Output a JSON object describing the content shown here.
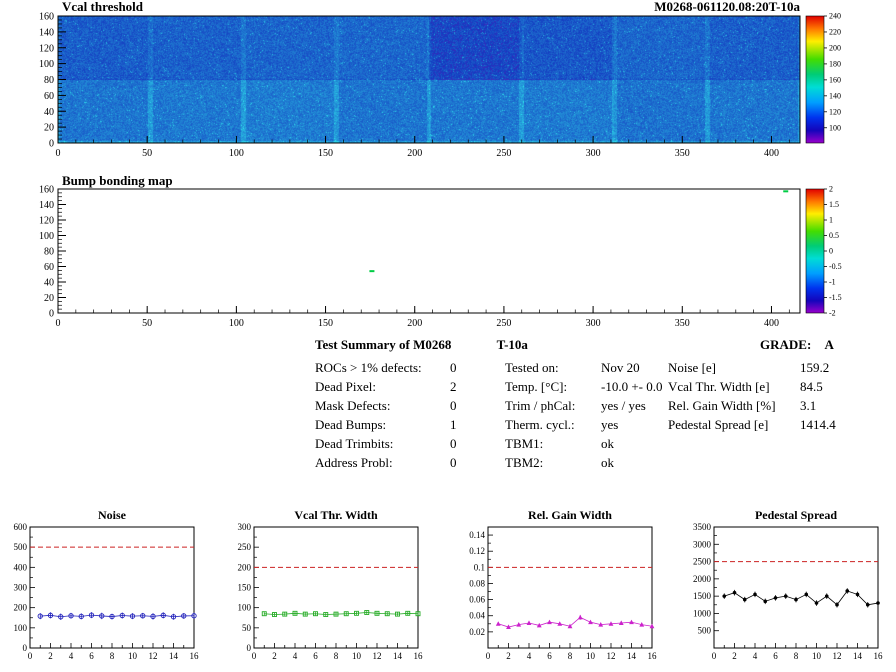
{
  "summary": {
    "title": "Test Summary of M0268",
    "subtitle": "T-10a",
    "grade_label": "GRADE:",
    "grade": "A",
    "defects": [
      {
        "label": "ROCs > 1% defects:",
        "value": "0"
      },
      {
        "label": "Dead Pixel:",
        "value": "2"
      },
      {
        "label": "Mask Defects:",
        "value": "0"
      },
      {
        "label": "Dead Bumps:",
        "value": "1"
      },
      {
        "label": "Dead Trimbits:",
        "value": "0"
      },
      {
        "label": "Address Probl:",
        "value": "0"
      }
    ],
    "conditions": [
      {
        "label": "Tested on:",
        "value": "Nov 20"
      },
      {
        "label": "Temp. [°C]:",
        "value": "-10.0 +- 0.0"
      },
      {
        "label": "Trim / phCal:",
        "value": "yes / yes"
      },
      {
        "label": "Therm. cycl.:",
        "value": "yes"
      },
      {
        "label": "TBM1:",
        "value": "ok"
      },
      {
        "label": "TBM2:",
        "value": "ok"
      }
    ],
    "results": [
      {
        "label": "Noise [e]",
        "value": "159.2"
      },
      {
        "label": "Vcal Thr. Width [e]",
        "value": "84.5"
      },
      {
        "label": "Rel. Gain Width [%]",
        "value": "3.1"
      },
      {
        "label": "Pedestal Spread [e]",
        "value": "1414.4"
      }
    ]
  },
  "chart_data": [
    {
      "id": "vcal_threshold_map",
      "type": "heatmap",
      "title": "Vcal threshold",
      "annotation": "M0268-061120.08:20T-10a",
      "xlim": [
        0,
        416
      ],
      "ylim": [
        0,
        160
      ],
      "xticks": [
        0,
        50,
        100,
        150,
        200,
        250,
        300,
        350,
        400
      ],
      "yticks": [
        0,
        20,
        40,
        60,
        80,
        100,
        120,
        140,
        160
      ],
      "zmin": 100,
      "zmax": 240,
      "colorbar_ticks": [
        240,
        220,
        200,
        180,
        160,
        140,
        120,
        100
      ],
      "z_typical_range": [
        100,
        150
      ],
      "structure": "16 ROCs in 2 rows of 8; speckled blue/cyan threshold map, ROC boundaries every 52 columns, darker region around x=210-310 in upper row"
    },
    {
      "id": "bump_bonding_map",
      "type": "heatmap",
      "title": "Bump bonding map",
      "xlim": [
        0,
        416
      ],
      "ylim": [
        0,
        160
      ],
      "xticks": [
        0,
        50,
        100,
        150,
        200,
        250,
        300,
        350,
        400
      ],
      "yticks": [
        0,
        20,
        40,
        60,
        80,
        100,
        120,
        140,
        160
      ],
      "zmin": -2,
      "zmax": 2,
      "colorbar_ticks": [
        2,
        1.5,
        1,
        0.5,
        0,
        -0.5,
        -1,
        -1.5,
        -2
      ],
      "points": [
        {
          "x": 176,
          "y": 54,
          "value": 0.2
        },
        {
          "x": 408,
          "y": 157,
          "value": 0.2
        }
      ]
    },
    {
      "id": "noise",
      "type": "scatter",
      "title": "Noise",
      "x": [
        1,
        2,
        3,
        4,
        5,
        6,
        7,
        8,
        9,
        10,
        11,
        12,
        13,
        14,
        15,
        16
      ],
      "values": [
        158,
        162,
        155,
        160,
        157,
        163,
        159,
        156,
        161,
        158,
        160,
        157,
        162,
        155,
        159,
        160
      ],
      "errors": [
        15,
        15,
        16,
        14,
        15,
        15,
        16,
        14,
        15,
        15,
        14,
        16,
        15,
        15,
        14,
        15
      ],
      "xlim": [
        0,
        16
      ],
      "xticks": [
        0,
        2,
        4,
        6,
        8,
        10,
        12,
        14,
        16
      ],
      "ylim": [
        0,
        600
      ],
      "yticks": [
        0,
        100,
        200,
        300,
        400,
        500,
        600
      ],
      "limit": 500,
      "marker": "circle",
      "color": "#2222bb",
      "limit_color": "#cc2222"
    },
    {
      "id": "vcal_thr_width",
      "type": "scatter",
      "title": "Vcal Thr. Width",
      "x": [
        1,
        2,
        3,
        4,
        5,
        6,
        7,
        8,
        9,
        10,
        11,
        12,
        13,
        14,
        15,
        16
      ],
      "values": [
        85,
        83,
        84,
        86,
        84,
        85,
        83,
        84,
        85,
        86,
        88,
        86,
        85,
        84,
        86,
        85
      ],
      "errors": [
        4,
        4,
        4,
        4,
        4,
        4,
        4,
        4,
        4,
        4,
        4,
        4,
        4,
        4,
        4,
        4
      ],
      "xlim": [
        0,
        16
      ],
      "xticks": [
        0,
        2,
        4,
        6,
        8,
        10,
        12,
        14,
        16
      ],
      "ylim": [
        0,
        300
      ],
      "yticks": [
        0,
        50,
        100,
        150,
        200,
        250,
        300
      ],
      "limit": 200,
      "marker": "square",
      "color": "#22aa22",
      "limit_color": "#cc2222"
    },
    {
      "id": "rel_gain_width",
      "type": "scatter",
      "title": "Rel. Gain Width",
      "x": [
        1,
        2,
        3,
        4,
        5,
        6,
        7,
        8,
        9,
        10,
        11,
        12,
        13,
        14,
        15,
        16
      ],
      "values": [
        0.03,
        0.026,
        0.029,
        0.031,
        0.028,
        0.032,
        0.03,
        0.027,
        0.038,
        0.032,
        0.029,
        0.03,
        0.031,
        0.032,
        0.029,
        0.027
      ],
      "errors": [
        0.002,
        0.002,
        0.002,
        0.002,
        0.002,
        0.002,
        0.002,
        0.002,
        0.003,
        0.002,
        0.002,
        0.002,
        0.002,
        0.002,
        0.002,
        0.002
      ],
      "xlim": [
        0,
        16
      ],
      "xticks": [
        0,
        2,
        4,
        6,
        8,
        10,
        12,
        14,
        16
      ],
      "ylim": [
        0,
        0.15
      ],
      "yticks": [
        0.02,
        0.04,
        0.06,
        0.08,
        0.1,
        0.12,
        0.14
      ],
      "limit": 0.1,
      "marker": "triangle",
      "color": "#cc22cc",
      "limit_color": "#cc2222"
    },
    {
      "id": "pedestal_spread",
      "type": "scatter",
      "title": "Pedestal Spread",
      "x": [
        1,
        2,
        3,
        4,
        5,
        6,
        7,
        8,
        9,
        10,
        11,
        12,
        13,
        14,
        15,
        16
      ],
      "values": [
        1500,
        1600,
        1400,
        1550,
        1350,
        1450,
        1500,
        1400,
        1550,
        1300,
        1500,
        1250,
        1650,
        1550,
        1250,
        1300
      ],
      "errors": [
        80,
        80,
        80,
        80,
        80,
        80,
        80,
        80,
        80,
        80,
        80,
        80,
        80,
        80,
        80,
        80
      ],
      "xlim": [
        0,
        16
      ],
      "xticks": [
        0,
        2,
        4,
        6,
        8,
        10,
        12,
        14,
        16
      ],
      "ylim": [
        0,
        3500
      ],
      "yticks": [
        500,
        1000,
        1500,
        2000,
        2500,
        3000,
        3500
      ],
      "limit": 2500,
      "marker": "dot",
      "color": "#000000",
      "limit_color": "#cc2222"
    }
  ]
}
